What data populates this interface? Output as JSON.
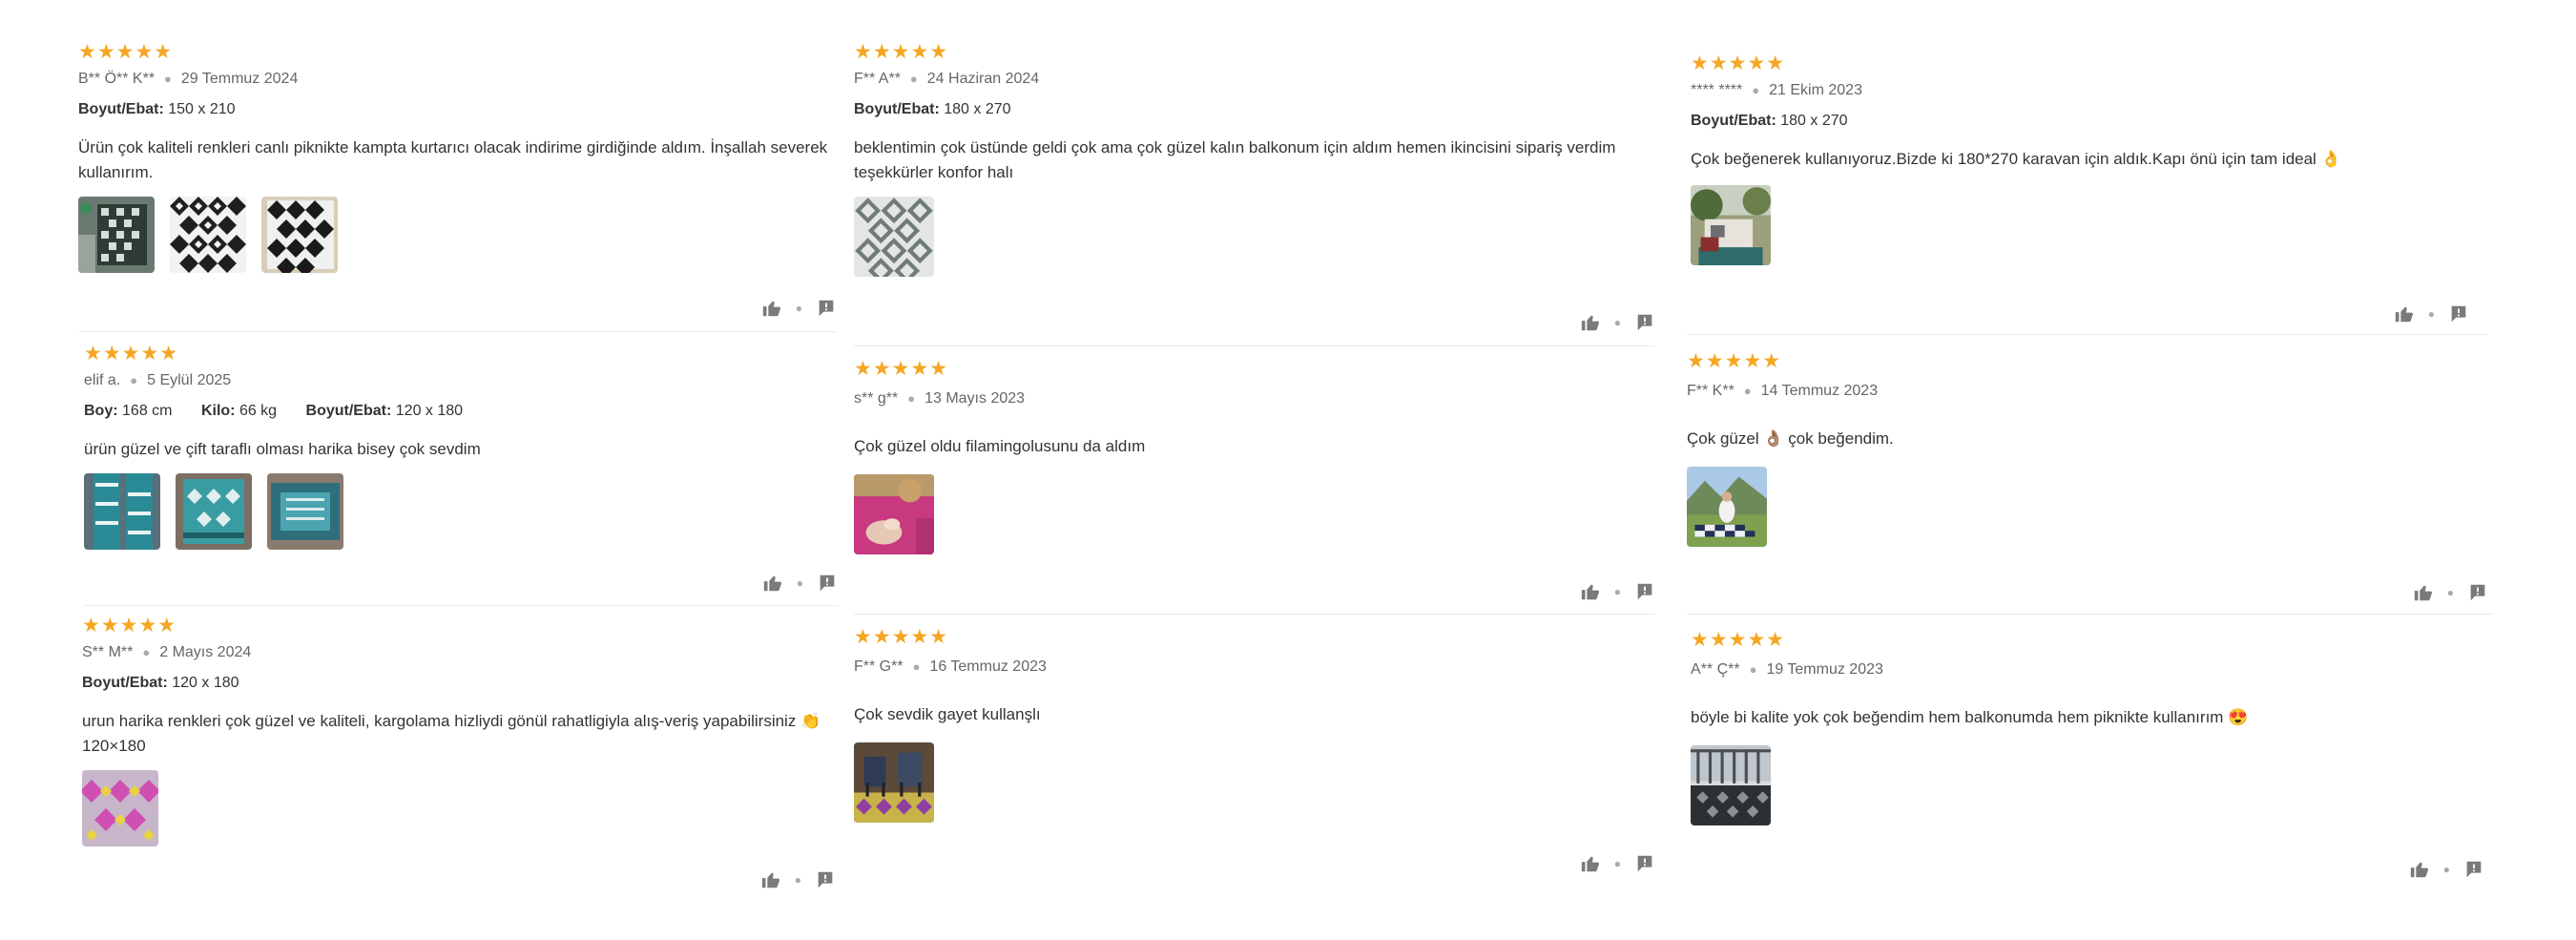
{
  "colors": {
    "star": "#f5a623",
    "text": "#333333",
    "meta": "#666666",
    "icon": "#7a7a7a"
  },
  "icons": {
    "rating": "star-icon",
    "like": "thumbs-up-icon",
    "report": "flag-icon"
  },
  "reviews": [
    {
      "stars": "★★★★★",
      "author": "B** Ö** K**",
      "date": "29 Temmuz 2024",
      "attrs": [
        {
          "label": "Boyut/Ebat:",
          "value": "150 x 210"
        }
      ],
      "text": "Ürün çok kaliteli renkleri canlı piknikte kampta kurtarıcı olacak indirime girdiğinde aldım. İnşallah severek kullanırım.",
      "photos": [
        "grid-rug-outdoor",
        "diamond-rug-black",
        "diamond-rug-black"
      ]
    },
    {
      "stars": "★★★★★",
      "author": "elif a.",
      "date": "5 Eylül 2025",
      "attrs": [
        {
          "label": "Boy:",
          "value": "168 cm"
        },
        {
          "label": "Kilo:",
          "value": "66 kg"
        },
        {
          "label": "Boyut/Ebat:",
          "value": "120 x 180"
        }
      ],
      "text": "ürün güzel ve çift taraflı olması harika bisey çok sevdim",
      "photos": [
        "teal-rug",
        "teal-rug",
        "teal-rug"
      ]
    },
    {
      "stars": "★★★★★",
      "author": "S** M**",
      "date": "2 Mayıs 2024",
      "attrs": [
        {
          "label": "Boyut/Ebat:",
          "value": "120 x 180"
        }
      ],
      "text": "urun harika renkleri çok güzel ve kaliteli, kargolama hizliydi gönül rahatligiyla alış-veriş yapabilirsiniz 👏 120×180",
      "photos": [
        "pink-yellow-rug"
      ]
    },
    {
      "stars": "★★★★★",
      "author": "F** A**",
      "date": "24 Haziran 2024",
      "attrs": [
        {
          "label": "Boyut/Ebat:",
          "value": "180 x 270"
        }
      ],
      "text": "beklentimin çok üstünde geldi çok ama çok güzel kalın balkonum için aldım hemen ikincisini sipariş verdim teşekkürler konfor halı",
      "photos": [
        "grey-diamond-rug"
      ]
    },
    {
      "stars": "★★★★★",
      "author": "s** g**",
      "date": "13 Mayıs 2023",
      "attrs": [],
      "text": "Çok güzel oldu filamingolusunu da aldım",
      "photos": [
        "pink-flamingo-rug"
      ]
    },
    {
      "stars": "★★★★★",
      "author": "F** G**",
      "date": "16 Temmuz 2023",
      "attrs": [],
      "text": "Çok sevdik gayet kullanşlı",
      "photos": [
        "camping-chairs"
      ]
    },
    {
      "stars": "★★★★★",
      "author": "**** ****",
      "date": "21 Ekim 2023",
      "attrs": [
        {
          "label": "Boyut/Ebat:",
          "value": "180 x 270"
        }
      ],
      "text": "Çok beğenerek kullanıyoruz.Bizde ki 180*270 karavan için aldık.Kapı önü için tam ideal 👌",
      "photos": [
        "caravan-garden"
      ]
    },
    {
      "stars": "★★★★★",
      "author": "F** K**",
      "date": "14 Temmuz 2023",
      "attrs": [],
      "text": "Çok güzel 👌🏽 çok beğendim.",
      "photos": [
        "picnic-mountain"
      ]
    },
    {
      "stars": "★★★★★",
      "author": "A** Ç**",
      "date": "19 Temmuz 2023",
      "attrs": [],
      "text": "böyle bi kalite yok çok beğendim hem balkonumda hem piknikte kullanırım 😍",
      "photos": [
        "balcony-rug"
      ]
    }
  ]
}
